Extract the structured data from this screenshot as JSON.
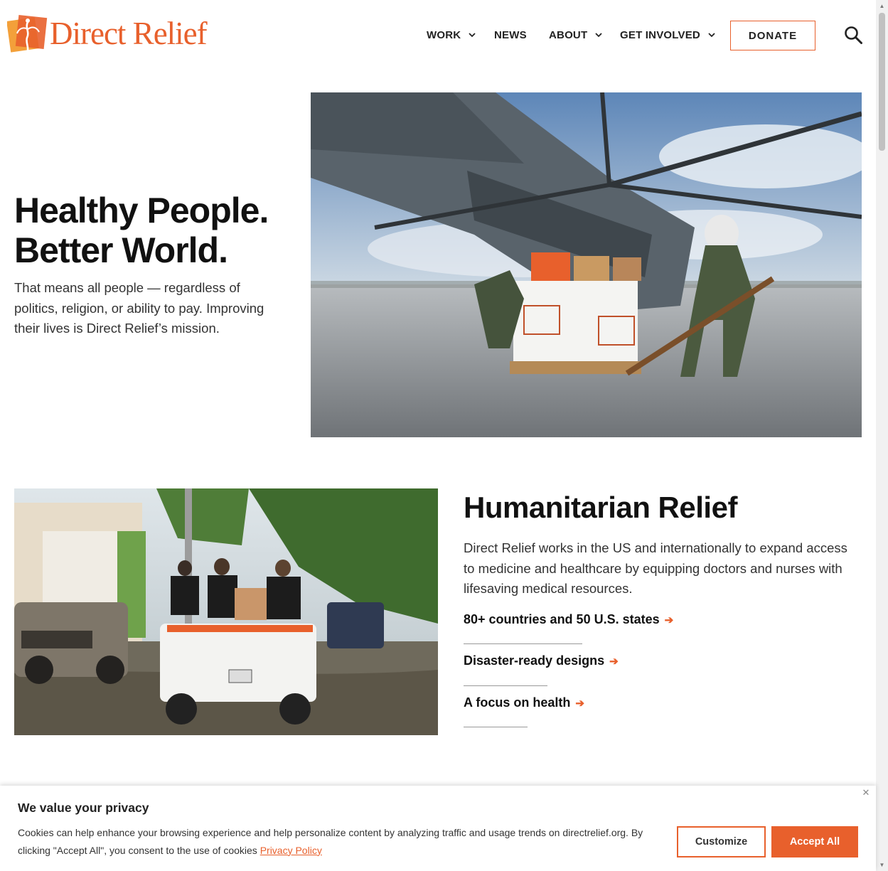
{
  "brand": {
    "name": "Direct Relief",
    "accent": "#e8602c"
  },
  "nav": {
    "items": [
      {
        "label": "WORK",
        "has_dropdown": true
      },
      {
        "label": "NEWS",
        "has_dropdown": false
      },
      {
        "label": "ABOUT",
        "has_dropdown": true
      },
      {
        "label": "GET INVOLVED",
        "has_dropdown": true
      }
    ],
    "donate_label": "DONATE",
    "search_icon": "search-icon"
  },
  "hero": {
    "title_line1": "Healthy People.",
    "title_line2": "Better World.",
    "subtitle": "That means all people — regardless of politics, religion, or ability to pay. Improving their lives is Direct Relief’s mission.",
    "image": "helicopter-cargo-photo"
  },
  "humanitarian": {
    "title": "Humanitarian Relief",
    "body": "Direct Relief works in the US and internationally to expand access to medicine and healthcare by equipping doctors and nurses with lifesaving medical resources.",
    "image": "emergency-response-truck-photo",
    "links": [
      {
        "label": "80+ countries and 50 U.S. states",
        "arrow": "➔"
      },
      {
        "label": "Disaster-ready designs",
        "arrow": "➔"
      },
      {
        "label": "A focus on health",
        "arrow": "➔"
      }
    ]
  },
  "cookie": {
    "title": "We value your privacy",
    "text": "Cookies can help enhance your browsing experience and help personalize content by analyzing traffic and usage trends on directrelief.org. By clicking \"Accept All\", you consent to the use of cookies",
    "policy_link": "Privacy Policy",
    "customize_label": "Customize",
    "accept_label": "Accept All",
    "close_icon": "close-icon"
  }
}
